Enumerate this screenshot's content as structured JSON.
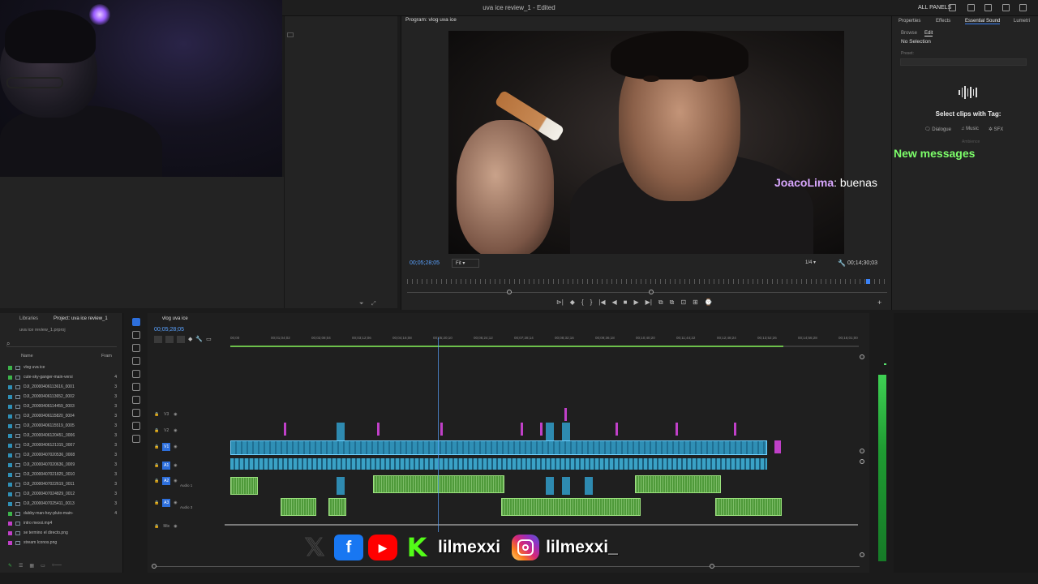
{
  "app": {
    "document_title": "uva ice review_1 - Edited",
    "all_panels_label": "ALL PANELS"
  },
  "program_monitor": {
    "tab_label": "Program: vlog uva ice",
    "timecode": "00;05;28;05",
    "fit_label": "Fit",
    "quality_label": "1/4",
    "duration": "00;14;30;03",
    "controls": [
      "⊳|",
      "◆",
      "{",
      "}",
      "|◀",
      "◀",
      "■",
      "▶",
      "▶|",
      "⧉",
      "⧉",
      "⊡",
      "⊞",
      "⌚"
    ]
  },
  "chat": {
    "new_messages": "New messages",
    "username": "JoacoLima",
    "message": "buenas"
  },
  "right_panel": {
    "tabs": [
      "Properties",
      "Effects",
      "Essential Sound",
      "Lumetri"
    ],
    "active_tab": "Essential Sound",
    "subtabs": [
      "Browse",
      "Edit"
    ],
    "no_selection": "No Selection",
    "preset_label": "Preset:",
    "select_clips_text": "Select clips with Tag:",
    "tags": [
      "Dialogue",
      "Music",
      "SFX"
    ],
    "ambience_tag": "Ambience"
  },
  "project_panel": {
    "tabs": [
      "Libraries",
      "Project: uva ice review_1"
    ],
    "file_name": "uva ice review_1.prproj",
    "columns": {
      "name": "Name",
      "frame_rate": "Fram"
    },
    "items": [
      {
        "name": "vlog uva ice",
        "rate": "",
        "color": "#3cb44b"
      },
      {
        "name": "cute-sky-ganger-main-versi",
        "rate": "4",
        "color": "#3cb44b"
      },
      {
        "name": "DJI_20000406113616_0001",
        "rate": "3",
        "color": "#2f8fb5"
      },
      {
        "name": "DJI_20000406113652_0002",
        "rate": "3",
        "color": "#2f8fb5"
      },
      {
        "name": "DJI_20000406114459_0003",
        "rate": "3",
        "color": "#2f8fb5"
      },
      {
        "name": "DJI_20000406115820_0004",
        "rate": "3",
        "color": "#2f8fb5"
      },
      {
        "name": "DJI_20000406115519_0005",
        "rate": "3",
        "color": "#2f8fb5"
      },
      {
        "name": "DJI_20000406120451_0006",
        "rate": "3",
        "color": "#2f8fb5"
      },
      {
        "name": "DJI_20000406121315_0007",
        "rate": "3",
        "color": "#2f8fb5"
      },
      {
        "name": "DJI_20000407020536_0008",
        "rate": "3",
        "color": "#2f8fb5"
      },
      {
        "name": "DJI_20000407020636_0009",
        "rate": "3",
        "color": "#2f8fb5"
      },
      {
        "name": "DJI_20000407021825_0010",
        "rate": "3",
        "color": "#2f8fb5"
      },
      {
        "name": "DJI_20000407022619_0011",
        "rate": "3",
        "color": "#2f8fb5"
      },
      {
        "name": "DJI_20000407024829_0012",
        "rate": "3",
        "color": "#2f8fb5"
      },
      {
        "name": "DJI_20000407025411_0013",
        "rate": "3",
        "color": "#2f8fb5"
      },
      {
        "name": "dubby-man-hey-pluto-main-",
        "rate": "4",
        "color": "#3cb44b"
      },
      {
        "name": "intro mexxi.mp4",
        "rate": "",
        "color": "#c040c8"
      },
      {
        "name": "se termino el directo.png",
        "rate": "",
        "color": "#c040c8"
      },
      {
        "name": "stream Iconos.png",
        "rate": "",
        "color": "#c040c8"
      }
    ]
  },
  "timeline": {
    "sequence_tab": "vlog uva ice",
    "timecode": "00;05;28;05",
    "ruler_ticks": [
      "00;00",
      "00;01;04;02",
      "00;02;08;04",
      "00;03;12;06",
      "00;04;16;08",
      "00;05;20;10",
      "00;06;24;12",
      "00;07;28;14",
      "00;08;32;16",
      "00;09;36;18",
      "00;10;40;20",
      "00;11;44;22",
      "00;12;48;24",
      "00;13;52;26",
      "00;14;56;28",
      "00;16;01;00"
    ],
    "tracks": [
      {
        "label": "V3",
        "on": false
      },
      {
        "label": "V2",
        "on": false
      },
      {
        "label": "V1",
        "on": true
      },
      {
        "label": "A1",
        "on": true
      },
      {
        "label": "A2",
        "on": true,
        "name": "Audio 1"
      },
      {
        "label": "A3",
        "on": true,
        "name": "Audio 3"
      },
      {
        "label": "Mix",
        "on": false
      }
    ]
  },
  "social": {
    "handle_kick": "lilmexxi",
    "handle_instagram": "lilmexxi_",
    "icons": [
      "x-icon",
      "facebook-icon",
      "youtube-icon",
      "kick-icon",
      "instagram-icon"
    ]
  },
  "colors": {
    "accent": "#2d6fdc",
    "video_clip": "#2f8fb5",
    "audio_clip": "#4f9a3a",
    "chat_name": "#d9a7ff",
    "new_messages": "#7dff6a"
  }
}
